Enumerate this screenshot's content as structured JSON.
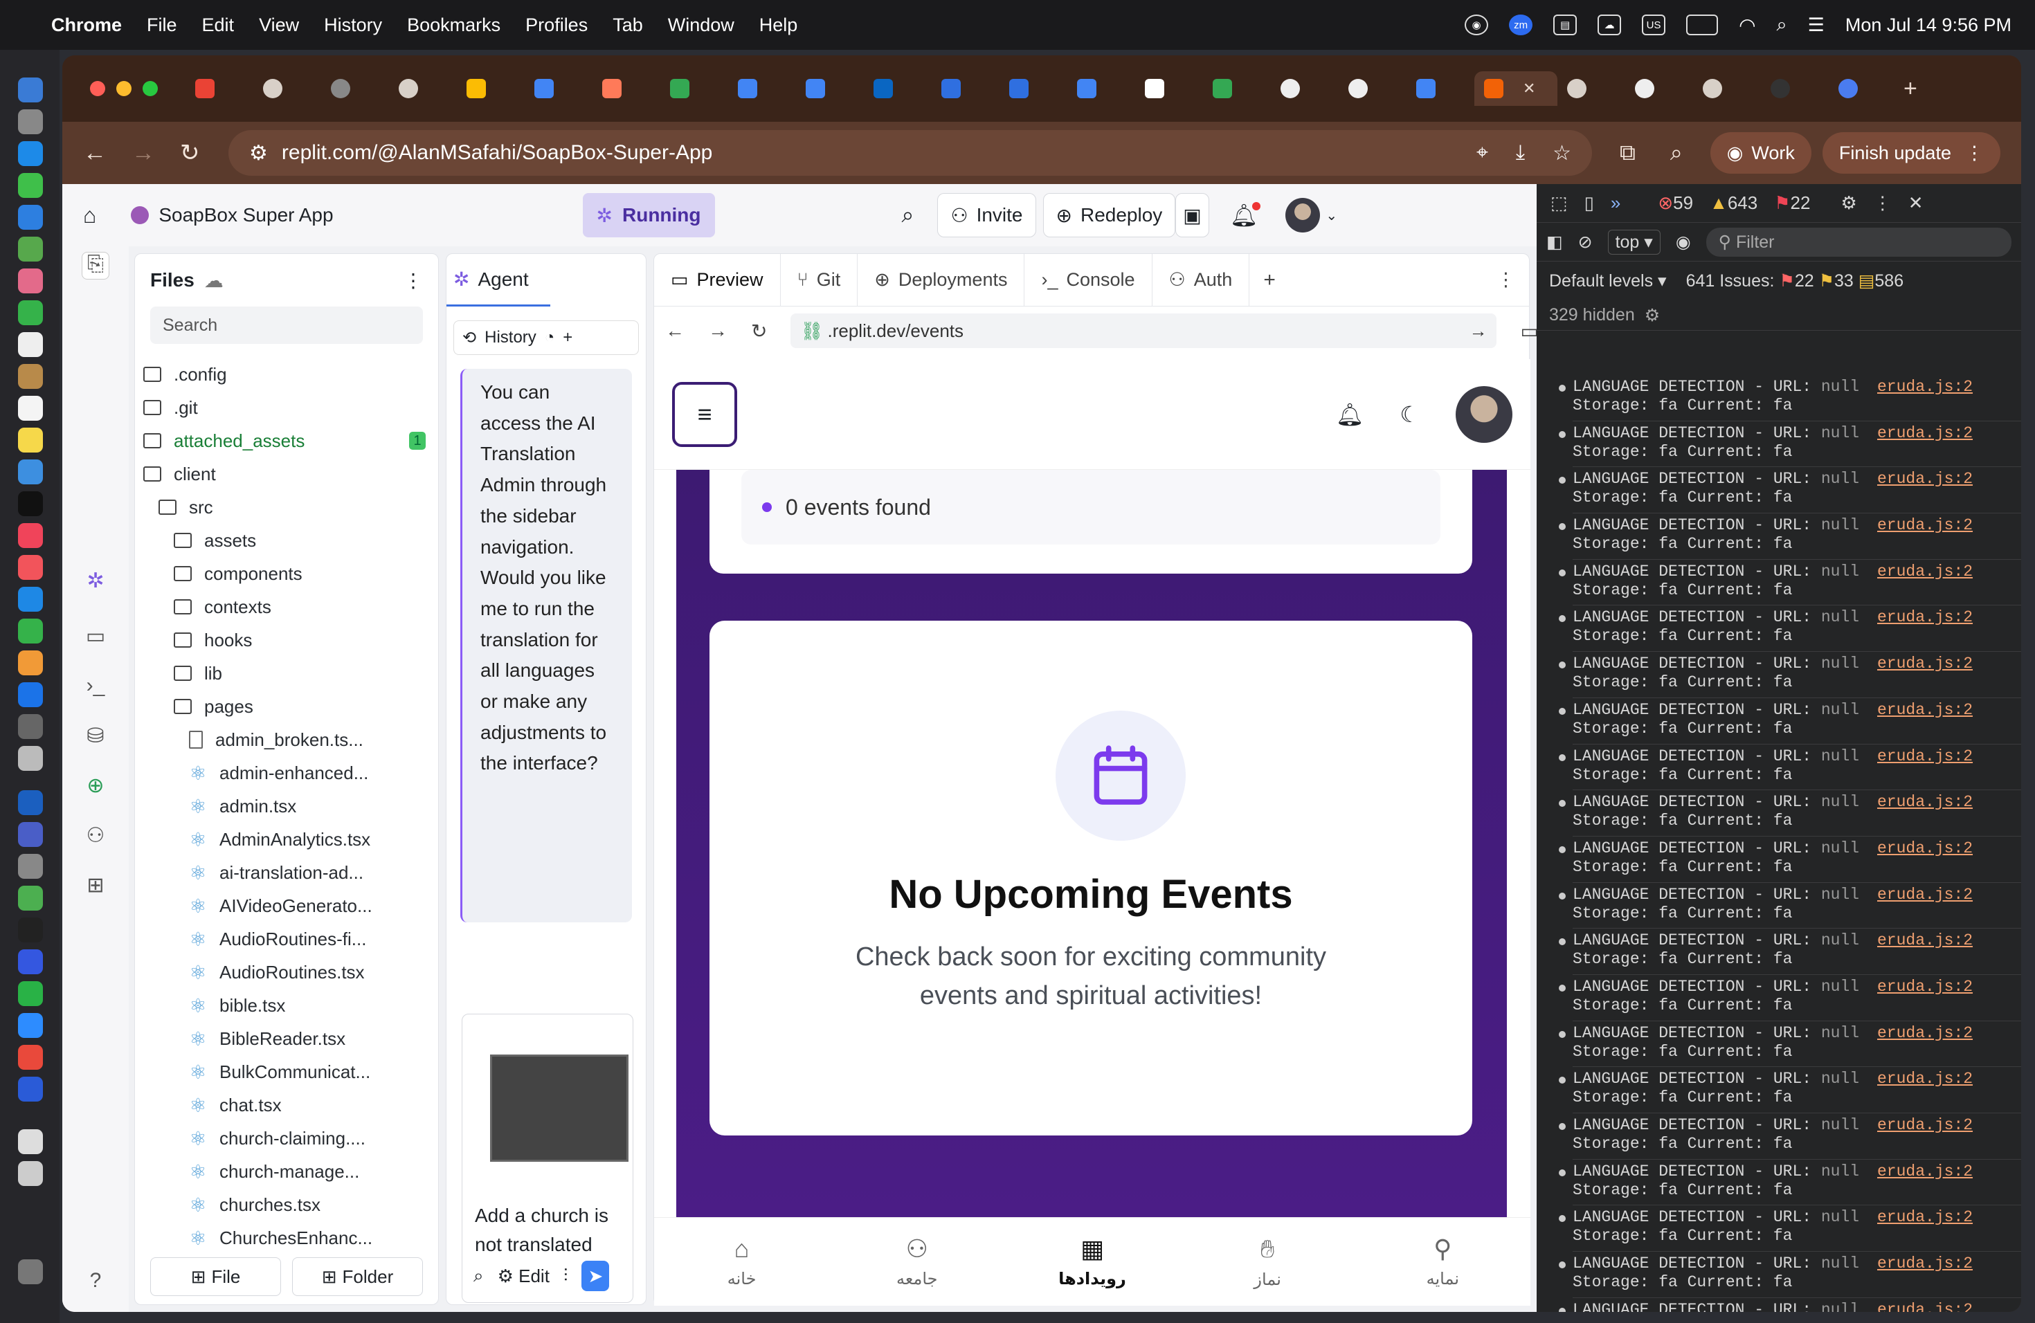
{
  "menubar": {
    "app": "Chrome",
    "items": [
      "File",
      "Edit",
      "View",
      "History",
      "Bookmarks",
      "Profiles",
      "Tab",
      "Window",
      "Help"
    ],
    "clock": "Mon Jul 14  9:56 PM",
    "input_source": "US",
    "zoom_badge": "zm"
  },
  "browser": {
    "url": "replit.com/@AlanMSafahi/SoapBox-Super-App",
    "work_label": "Work",
    "finish_update_label": "Finish update"
  },
  "replit": {
    "app_name": "SoapBox Super App",
    "running_label": "Running",
    "invite_label": "Invite",
    "redeploy_label": "Redeploy",
    "files": {
      "title": "Files",
      "search_placeholder": "Search",
      "tree": [
        {
          "name": ".config",
          "type": "folder",
          "depth": 0
        },
        {
          "name": ".git",
          "type": "folder",
          "depth": 0
        },
        {
          "name": "attached_assets",
          "type": "folder",
          "depth": 0,
          "badge": "1"
        },
        {
          "name": "client",
          "type": "folder",
          "depth": 0
        },
        {
          "name": "src",
          "type": "folder",
          "depth": 1
        },
        {
          "name": "assets",
          "type": "folder",
          "depth": 2
        },
        {
          "name": "components",
          "type": "folder",
          "depth": 2
        },
        {
          "name": "contexts",
          "type": "folder",
          "depth": 2
        },
        {
          "name": "hooks",
          "type": "folder",
          "depth": 2
        },
        {
          "name": "lib",
          "type": "folder",
          "depth": 2
        },
        {
          "name": "pages",
          "type": "folder",
          "depth": 2
        },
        {
          "name": "admin_broken.ts...",
          "type": "file",
          "depth": 3
        },
        {
          "name": "admin-enhanced...",
          "type": "react",
          "depth": 3
        },
        {
          "name": "admin.tsx",
          "type": "react",
          "depth": 3
        },
        {
          "name": "AdminAnalytics.tsx",
          "type": "react",
          "depth": 3
        },
        {
          "name": "ai-translation-ad...",
          "type": "react",
          "depth": 3
        },
        {
          "name": "AIVideoGenerato...",
          "type": "react",
          "depth": 3
        },
        {
          "name": "AudioRoutines-fi...",
          "type": "react",
          "depth": 3
        },
        {
          "name": "AudioRoutines.tsx",
          "type": "react",
          "depth": 3
        },
        {
          "name": "bible.tsx",
          "type": "react",
          "depth": 3
        },
        {
          "name": "BibleReader.tsx",
          "type": "react",
          "depth": 3
        },
        {
          "name": "BulkCommunicat...",
          "type": "react",
          "depth": 3
        },
        {
          "name": "chat.tsx",
          "type": "react",
          "depth": 3
        },
        {
          "name": "church-claiming....",
          "type": "react",
          "depth": 3
        },
        {
          "name": "church-manage...",
          "type": "react",
          "depth": 3
        },
        {
          "name": "churches.tsx",
          "type": "react",
          "depth": 3
        },
        {
          "name": "ChurchesEnhanc...",
          "type": "react",
          "depth": 3
        }
      ],
      "file_button": "File",
      "folder_button": "Folder"
    },
    "agent": {
      "title": "Agent",
      "history_label": "History",
      "message": "You can access the AI Translation Admin through the sidebar navigation. Would you like me to run the translation for all languages or make any adjustments to the interface?",
      "compose_text": "Add a church is not translated",
      "edit_label": "Edit"
    },
    "preview": {
      "tabs": [
        "Preview",
        "Git",
        "Deployments",
        "Console",
        "Auth"
      ],
      "url": ".replit.dev/events",
      "app": {
        "events_found": "0 events found",
        "empty_title": "No Upcoming Events",
        "empty_subtitle": "Check back soon for exciting community events and spiritual activities!",
        "nav": [
          "خانه",
          "جامعه",
          "رویدادها",
          "نماز",
          "نمایه"
        ]
      }
    }
  },
  "devtools": {
    "error_count": "59",
    "warning_count": "643",
    "info_count": "22",
    "context": "top",
    "filter_placeholder": "Filter",
    "levels": "Default levels",
    "issues": "641 Issues:",
    "issue_err": "22",
    "issue_warn": "33",
    "issue_info": "586",
    "hidden": "329 hidden",
    "log_line1": "LANGUAGE DETECTION - URL:",
    "log_null": "null",
    "log_line2": "Storage: fa Current: fa",
    "log_source": "eruda.js:2"
  }
}
